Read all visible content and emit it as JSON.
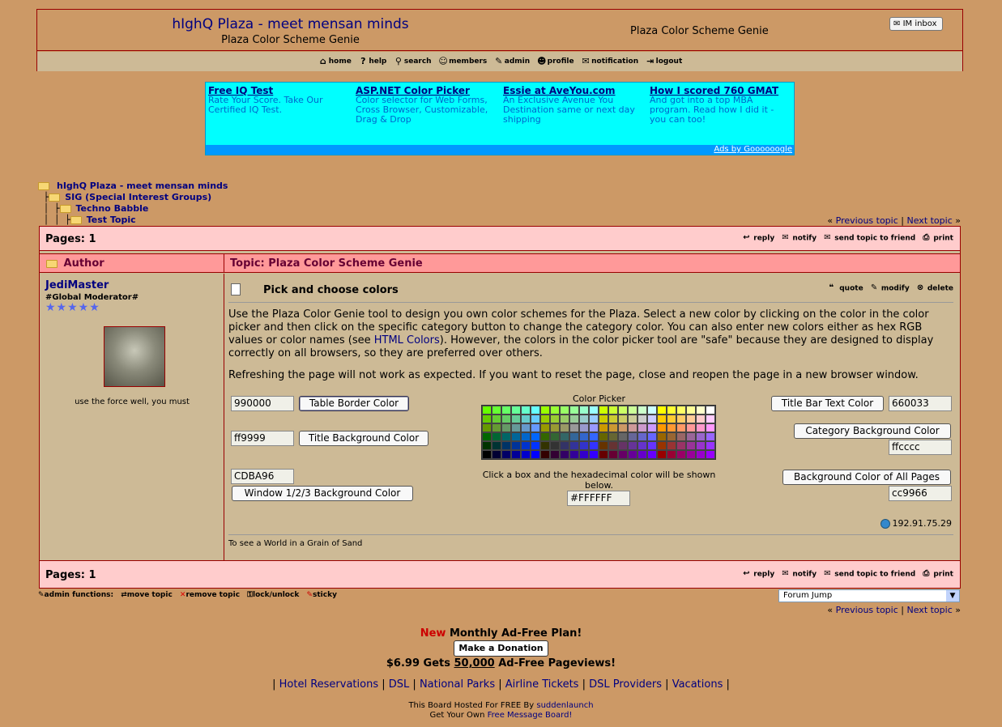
{
  "header": {
    "site_title": "hIghQ Plaza - meet mensan minds",
    "site_subtitle": "Plaza Color Scheme Genie",
    "right_title": "Plaza Color Scheme Genie",
    "im_inbox": "IM inbox"
  },
  "nav": [
    {
      "label": "home",
      "icon": "house-icon",
      "glyph": "⌂"
    },
    {
      "label": "help",
      "icon": "help-icon",
      "glyph": "?"
    },
    {
      "label": "search",
      "icon": "search-icon",
      "glyph": "⚲"
    },
    {
      "label": "members",
      "icon": "members-icon",
      "glyph": "☺"
    },
    {
      "label": "admin",
      "icon": "admin-icon",
      "glyph": "✎"
    },
    {
      "label": "profile",
      "icon": "profile-icon",
      "glyph": "☻"
    },
    {
      "label": "notification",
      "icon": "notification-icon",
      "glyph": "✉"
    },
    {
      "label": "logout",
      "icon": "logout-icon",
      "glyph": "⇥"
    }
  ],
  "ads": [
    {
      "title": "Free IQ Test",
      "text": "Rate Your Score. Take Our Certified IQ Test."
    },
    {
      "title": "ASP.NET Color Picker",
      "text": "Color selector for Web Forms, Cross Browser, Customizable, Drag & Drop"
    },
    {
      "title": "Essie at AveYou.com",
      "text": "An Exclusive Avenue You Destination same or next day shipping"
    },
    {
      "title": "How I scored 760 GMAT",
      "text": "And got into a top MBA program. Read how I did it - you can too!"
    }
  ],
  "ads_footer": "Ads by Goooooogle",
  "breadcrumb": [
    "hIghQ Plaza - meet mensan minds",
    "SIG (Special Interest Groups)",
    "Techno Babble",
    "Test Topic"
  ],
  "topic_nav": {
    "prefix": "«",
    "previous": "Previous topic",
    "sep": "|",
    "next": "Next topic",
    "suffix": "»"
  },
  "pages": {
    "label": "Pages: 1"
  },
  "topic_actions": [
    "reply",
    "notify",
    "send topic to friend",
    "print"
  ],
  "columns": {
    "author": "Author",
    "topic": "Topic: Plaza Color Scheme Genie"
  },
  "author": {
    "name": "JediMaster",
    "rank": "#Global Moderator#",
    "stars": "★★★★★",
    "tagline": "use the force well, you must"
  },
  "post": {
    "title": "Pick and choose colors",
    "actions": [
      "quote",
      "modify",
      "delete"
    ],
    "p1_a": "Use the Plaza Color Genie tool to design you own color schemes for the Plaza. Select a new color by clicking on the color in the color picker and then click on the specific category button to change the category color. You can also enter new colors either as hex RGB values or color names (see ",
    "p1_link": "HTML Colors",
    "p1_b": "). However, the colors in the color picker tool are \"safe\" because they are designed to display correctly on all browsers, so they are preferred over others.",
    "p2": "Refreshing the page will not work as expected. If you want to reset the page, close and reopen the page in a new browser window.",
    "ip": "192.91.75.29",
    "signature": "To see a World in a Grain of Sand"
  },
  "genie": {
    "table_border_value": "990000",
    "table_border_btn": "Table Border Color",
    "title_bg_value": "ff9999",
    "title_bg_btn": "Title Background Color",
    "window_bg_value": "CDBA96",
    "window_bg_btn": "Window 1/2/3 Background Color",
    "picker_title": "Color Picker",
    "picker_hint": "Click a box and the hexadecimal color will be shown below.",
    "picker_value": "#FFFFFF",
    "title_text_btn": "Title Bar Text Color",
    "title_text_value": "660033",
    "cat_bg_btn": "Category Background Color",
    "cat_bg_value": "ffcccc",
    "page_bg_btn": "Background Color of All Pages",
    "page_bg_value": "cc9966"
  },
  "admin": {
    "label": "admin functions:",
    "items": [
      "move topic",
      "remove topic",
      "lock/unlock",
      "sticky"
    ]
  },
  "forum_jump": "Forum Jump",
  "footer": {
    "new": "New",
    "plan": "Monthly Ad-Free Plan!",
    "donate": "Make a Donation",
    "price_a": "$6.99 Gets",
    "price_b": "50,000",
    "price_c": "Ad-Free Pageviews!",
    "links": [
      "Hotel Reservations",
      "DSL",
      "National Parks",
      "Airline Tickets",
      "DSL Providers",
      "Vacations"
    ],
    "hosted_a": "This Board Hosted For FREE By",
    "hosted_link": "suddenlaunch",
    "own_a": "Get Your Own",
    "own_link": "Free Message Board!"
  },
  "colors": {
    "page_bg": "#cc9966",
    "window_bg": "#cdba96",
    "title_bg": "#ff9999",
    "cat_bg": "#ffcccc",
    "border": "#990000",
    "title_text": "#660033"
  }
}
